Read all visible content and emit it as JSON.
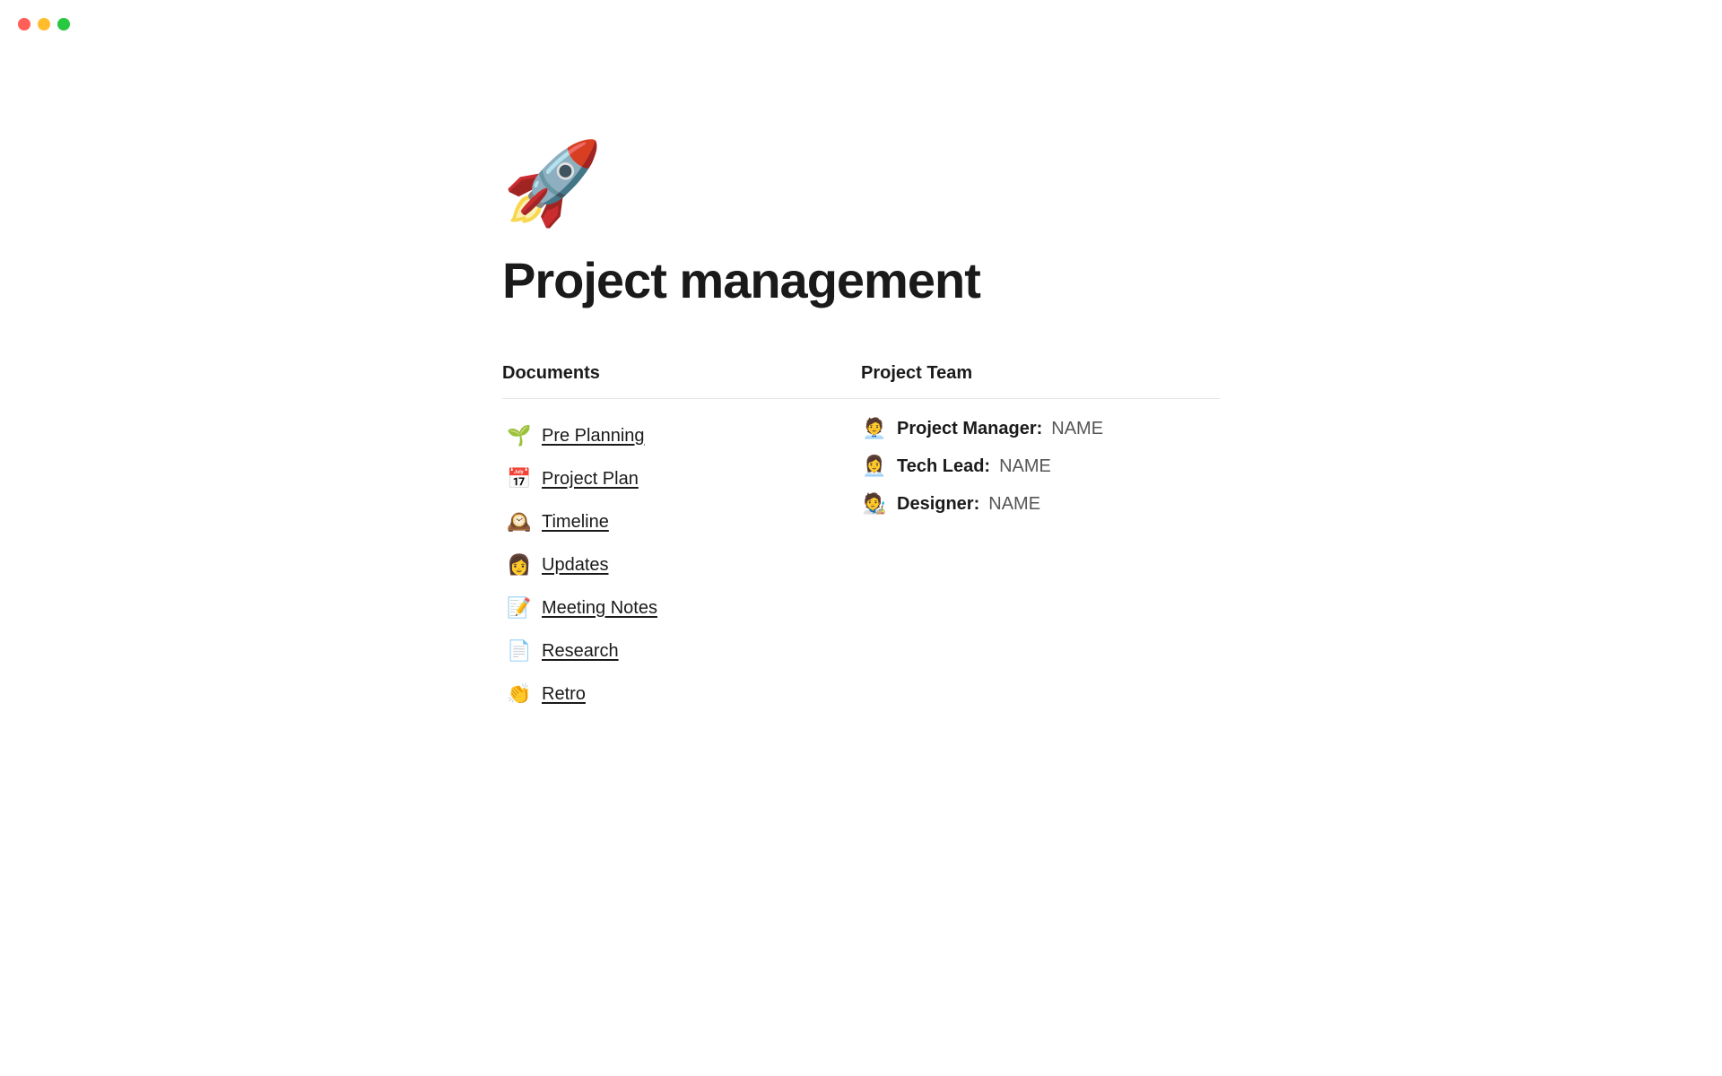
{
  "window": {
    "traffic_lights": {
      "red_label": "close",
      "yellow_label": "minimize",
      "green_label": "maximize"
    }
  },
  "page": {
    "icon": "🚀",
    "title": "Project management"
  },
  "documents": {
    "heading": "Documents",
    "items": [
      {
        "emoji": "🌱",
        "label": "Pre Planning"
      },
      {
        "emoji": "📅",
        "label": "Project Plan"
      },
      {
        "emoji": "🕰️",
        "label": "Timeline"
      },
      {
        "emoji": "👩",
        "label": "Updates"
      },
      {
        "emoji": "📝",
        "label": "Meeting Notes"
      },
      {
        "emoji": "📄",
        "label": "Research"
      },
      {
        "emoji": "👏",
        "label": "Retro"
      }
    ]
  },
  "project_team": {
    "heading": "Project Team",
    "members": [
      {
        "emoji": "🧑‍💼",
        "role": "Project Manager:",
        "name": "NAME"
      },
      {
        "emoji": "👩‍💼",
        "role": "Tech Lead:",
        "name": "NAME"
      },
      {
        "emoji": "🧑‍🎨",
        "role": "Designer:",
        "name": "NAME"
      }
    ]
  }
}
